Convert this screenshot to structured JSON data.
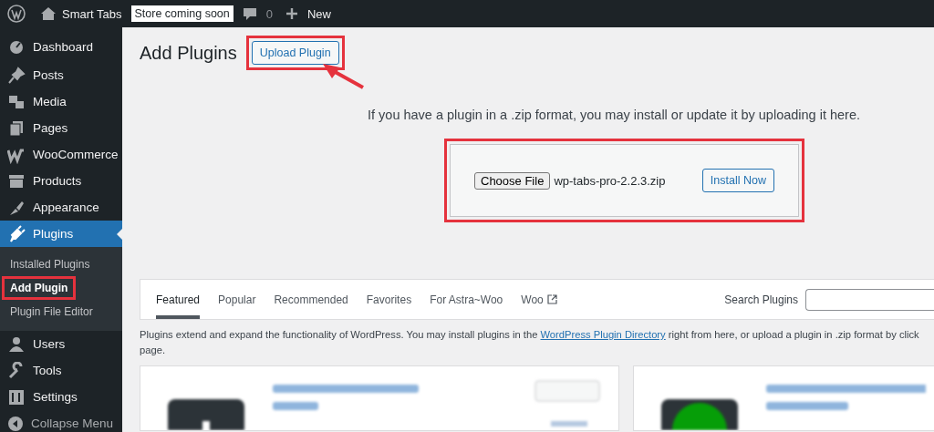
{
  "admin_bar": {
    "site_name": "Smart Tabs",
    "badge": "Store coming soon",
    "comments": "0",
    "new_label": "New"
  },
  "sidebar": {
    "items": [
      {
        "label": "Dashboard",
        "selected": false
      },
      {
        "label": "Posts",
        "selected": false
      },
      {
        "label": "Media",
        "selected": false
      },
      {
        "label": "Pages",
        "selected": false
      },
      {
        "label": "WooCommerce",
        "selected": false
      },
      {
        "label": "Products",
        "selected": false
      },
      {
        "label": "Appearance",
        "selected": false
      },
      {
        "label": "Plugins",
        "selected": true,
        "children": [
          {
            "label": "Installed Plugins",
            "selected": false,
            "highlighted": false
          },
          {
            "label": "Add Plugin",
            "selected": true,
            "highlighted": true
          },
          {
            "label": "Plugin File Editor",
            "selected": false,
            "highlighted": false
          }
        ]
      },
      {
        "label": "Users",
        "selected": false
      },
      {
        "label": "Tools",
        "selected": false
      },
      {
        "label": "Settings",
        "selected": false
      }
    ],
    "collapse_label": "Collapse Menu"
  },
  "page": {
    "title": "Add Plugins",
    "upload_button": {
      "label": "Upload Plugin",
      "highlighted": true
    },
    "upload_hint": "If you have a plugin in a .zip format, you may install or update it by uploading it here.",
    "upload_form": {
      "choose_label": "Choose File",
      "file_name": "wp-tabs-pro-2.2.3.zip",
      "install_label": "Install Now",
      "highlighted": true
    },
    "tabs": [
      {
        "label": "Featured",
        "selected": true,
        "external": false
      },
      {
        "label": "Popular",
        "selected": false,
        "external": false
      },
      {
        "label": "Recommended",
        "selected": false,
        "external": false
      },
      {
        "label": "Favorites",
        "selected": false,
        "external": false
      },
      {
        "label": "For Astra~Woo",
        "selected": false,
        "external": false
      },
      {
        "label": "Woo",
        "selected": false,
        "external": true
      }
    ],
    "search_label": "Search Plugins",
    "description": {
      "before": "Plugins extend and expand the functionality of WordPress. You may install plugins in the ",
      "link": "WordPress Plugin Directory",
      "after": " right from here, or upload a plugin in .zip format by click",
      "continuation": "page."
    }
  }
}
